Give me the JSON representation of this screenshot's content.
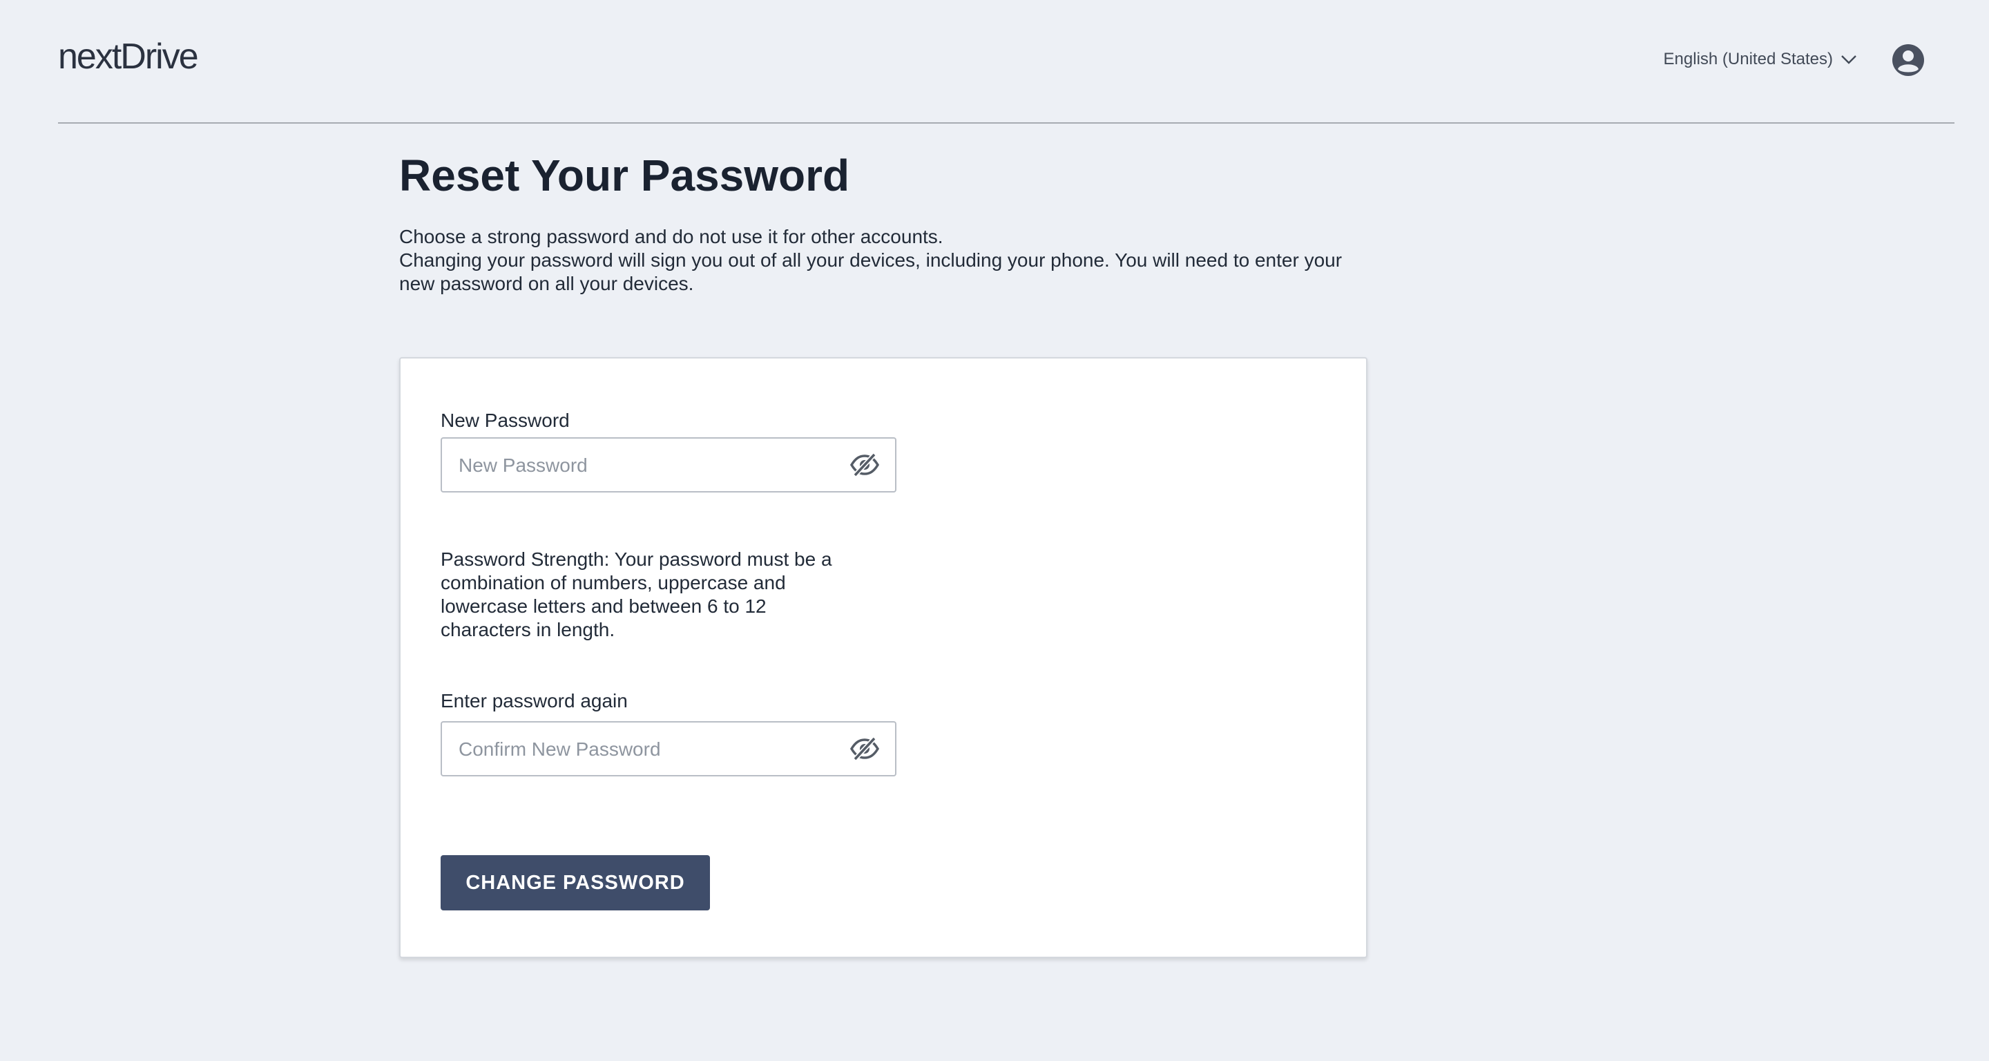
{
  "header": {
    "logo_text": "nextDrive",
    "language": "English (United States)",
    "language_icon": "chevron-down-icon",
    "account_icon": "user-circle-icon"
  },
  "main": {
    "title": "Reset Your Password",
    "description_line1": "Choose a strong password and do not use it for other accounts.",
    "description_line2": "Changing your password will sign you out of all your devices, including your phone. You will need to enter your\nnew password on all your devices."
  },
  "form": {
    "new_password": {
      "label": "New Password",
      "placeholder": "New Password",
      "value": "",
      "icon": "eye-slash-icon"
    },
    "strength_text": "Password Strength: Your password must be a combination of numbers, uppercase and lowercase letters and between 6 to 12 characters in length.",
    "confirm_password": {
      "label": "Enter password again",
      "placeholder": "Confirm New Password",
      "value": "",
      "icon": "eye-slash-icon"
    },
    "submit_label": "CHANGE PASSWORD"
  },
  "colors": {
    "background": "#edf0f5",
    "card": "#ffffff",
    "button": "#3f4d6a",
    "text": "#1f2733"
  }
}
